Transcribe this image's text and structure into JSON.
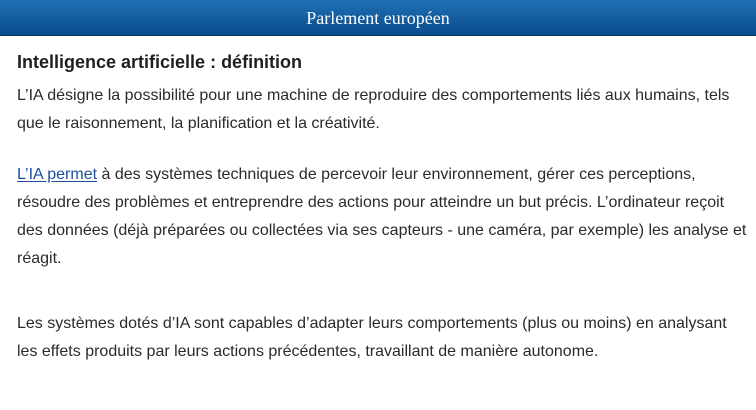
{
  "header": {
    "title": "Parlement européen"
  },
  "article": {
    "heading": "Intelligence artificielle : définition",
    "paragraph_1": "L’IA désigne la possibilité pour une machine de reproduire des comportements liés aux humains, tels que le raisonnement, la planification et la créativité.",
    "paragraph_2_link": "L’IA permet",
    "paragraph_2_rest": " à des systèmes techniques de percevoir leur environnement, gérer ces perceptions, résoudre des problèmes et entreprendre des actions pour atteindre un but précis. L’ordinateur reçoit des données (déjà préparées ou collectées via ses capteurs - une caméra, par exemple) les analyse et réagit.",
    "paragraph_3": "Les systèmes dotés d’IA sont capables d’adapter leurs comportements (plus ou moins) en analysant les effets produits par leurs actions précédentes, travaillant de manière autonome."
  },
  "colors": {
    "header_bar": "#0a4d8d",
    "link": "#1a4f9c",
    "body_text": "#2a2a2a"
  }
}
